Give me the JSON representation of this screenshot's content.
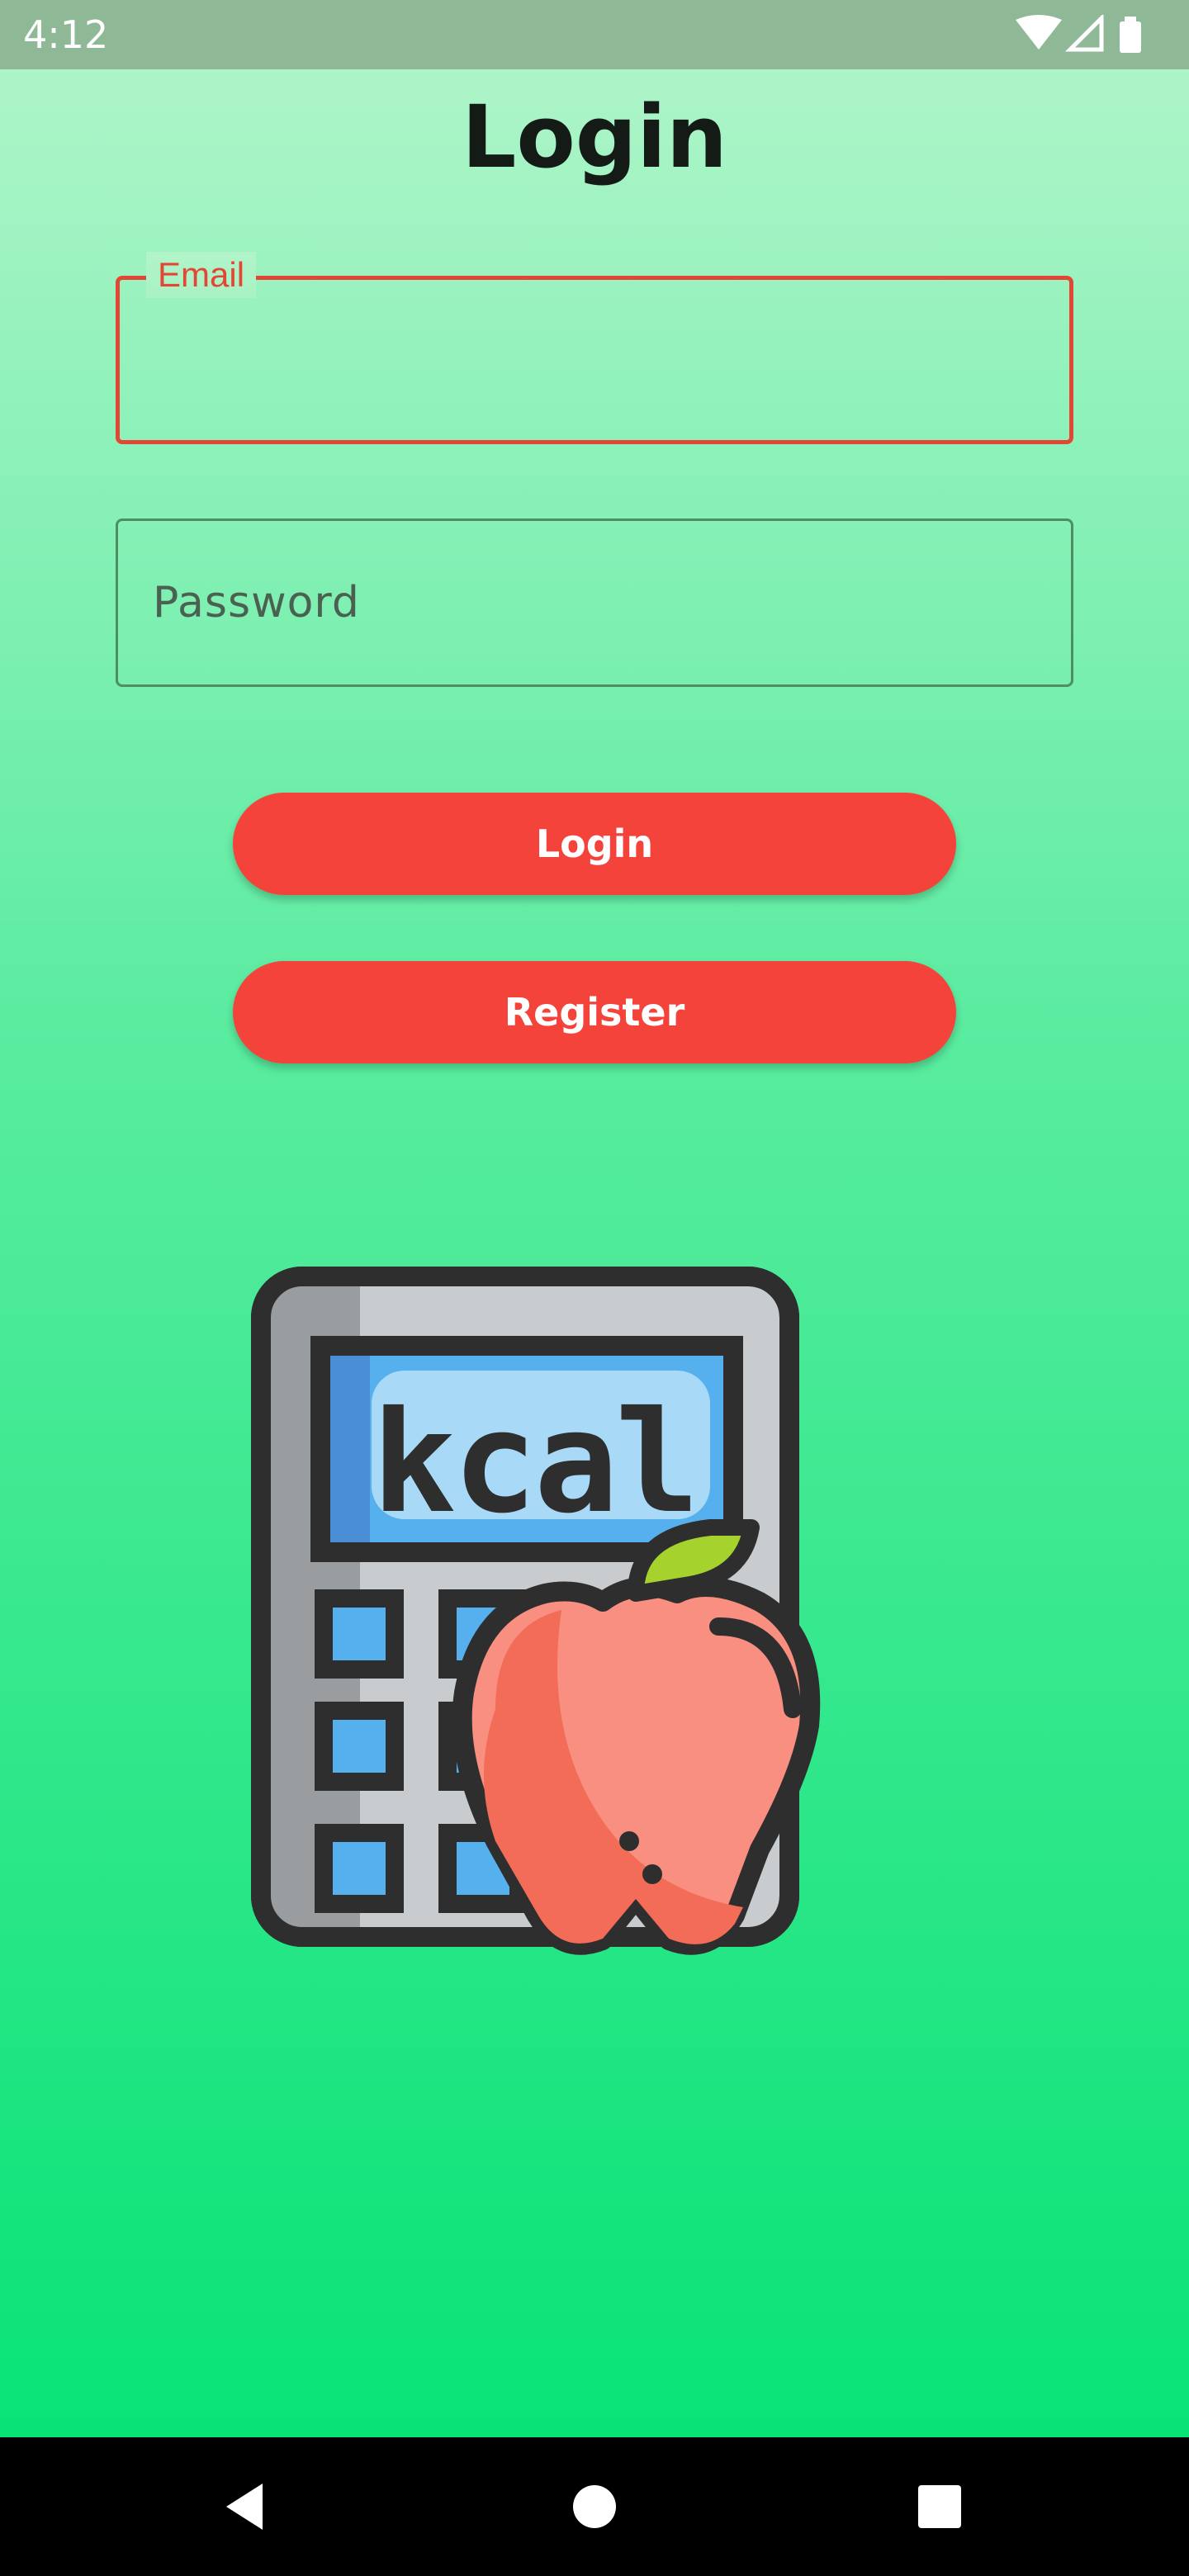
{
  "status_bar": {
    "time": "4:12",
    "icons": [
      "wifi-icon",
      "signal-icon",
      "battery-icon"
    ]
  },
  "page": {
    "title": "Login"
  },
  "form": {
    "email": {
      "label": "Email",
      "value": "",
      "placeholder": ""
    },
    "password": {
      "value": "",
      "placeholder": "Password"
    }
  },
  "buttons": {
    "login_label": "Login",
    "register_label": "Register"
  },
  "illustration": {
    "icon": "calculator-apple-icon",
    "screen_text": "kcal"
  },
  "nav_bar": {
    "icons": [
      "back-icon",
      "home-icon",
      "recents-icon"
    ]
  },
  "colors": {
    "accent": "#f4433a",
    "error_outline": "#e24634",
    "background_top": "#b3f5cb",
    "background_bottom": "#00e272"
  }
}
